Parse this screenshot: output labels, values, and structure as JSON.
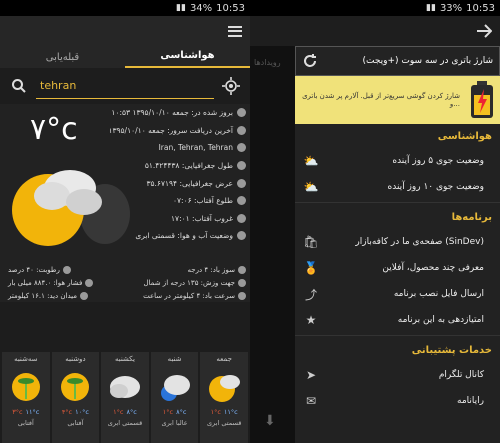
{
  "left": {
    "status": {
      "time": "10:53",
      "battery": "34%"
    },
    "tabs": {
      "active": "هواشناسی",
      "other": "قبله‌یابی"
    },
    "search": {
      "value": "tehran"
    },
    "weather": {
      "temp": "۷°c",
      "rows": [
        "بروز شده در: جمعه ۱۳۹۵/۱۰/۱۰ ۱۰:۵۳",
        "آخرین دریافت سرور: جمعه ۱۳۹۵/۱۰/۱۰ ۰۹:۳۰",
        "Iran, Tehran, Tehran",
        "طول جغرافیایی: ۵۱.۴۲۴۴۳۸",
        "عرض جغرافیایی: ۳۵.۶۷۱۹۴",
        "طلوع آفتاب: ۰۷:۰۶",
        "غروب آفتاب: ۱۷:۰۱",
        "وضعیت آب و هوا: قسمتی ابری"
      ],
      "extras": {
        "wind": "سوز باد: ۴ درجه",
        "humidity": "رطوبت: ۴۰ درصد",
        "direction": "جهت وزش: ۱۳۵ درجه از شمال",
        "pressure": "فشار هوا: ۸۸۴.۰ میلی بار",
        "speed": "سرعت باد: ۴ کیلومتر در ساعت",
        "visibility": "میدان دید: ۱۶.۱ کیلومتر"
      }
    },
    "forecast": [
      {
        "day": "سه‌شنبه",
        "lo": "۳°c",
        "hi": "۱۱°c",
        "cond": "آفتابی",
        "icon": "palm-sun"
      },
      {
        "day": "دوشنبه",
        "lo": "۴°c",
        "hi": "۱۰°c",
        "cond": "آفتابی",
        "icon": "palm-sun"
      },
      {
        "day": "یکشنبه",
        "lo": "۱°c",
        "hi": "۸°c",
        "cond": "قسمتی ابری",
        "icon": "cloud"
      },
      {
        "day": "شنبه",
        "lo": "۱°c",
        "hi": "۸°c",
        "cond": "عالبا ابری",
        "icon": "cloud-sun"
      },
      {
        "day": "جمعه",
        "lo": "۱°c",
        "hi": "۱۱°c",
        "cond": "قسمتی ابری",
        "icon": "sun-cloud"
      }
    ]
  },
  "right": {
    "status": {
      "time": "10:53",
      "battery": "33%"
    },
    "backdrop": {
      "tab": "رویدادها"
    },
    "banner": {
      "title": "شارژ باتری در سه سوت (+ویجت)"
    },
    "promo": {
      "text": "شارژ کردن گوشی سریع‌تر از قبل. آلارم پر شدن باتری و..."
    },
    "sections": [
      {
        "title": "هواشناسی",
        "items": [
          {
            "label": "وضعیت جوی ۵ روز آینده",
            "icon": "weather-icon"
          },
          {
            "label": "وضعیت جوی ۱۰ روز آینده",
            "icon": "weather-icon"
          }
        ]
      },
      {
        "title": "برنامه‌ها",
        "items": [
          {
            "label": "صفحه‌ی ما در کافه‌بازار (SinDev)",
            "icon": "shop-icon"
          },
          {
            "label": "معرفی چند محصول، آفلاین",
            "icon": "badge-icon"
          },
          {
            "label": "ارسال فایل نصب برنامه",
            "icon": "share-icon"
          },
          {
            "label": "امتیازدهی به این برنامه",
            "icon": "star-icon"
          }
        ]
      },
      {
        "title": "خدمات پشتیبانی",
        "items": [
          {
            "label": "کانال تلگرام",
            "icon": "telegram-icon"
          },
          {
            "label": "رایانامه",
            "icon": "mail-icon"
          }
        ]
      }
    ]
  }
}
